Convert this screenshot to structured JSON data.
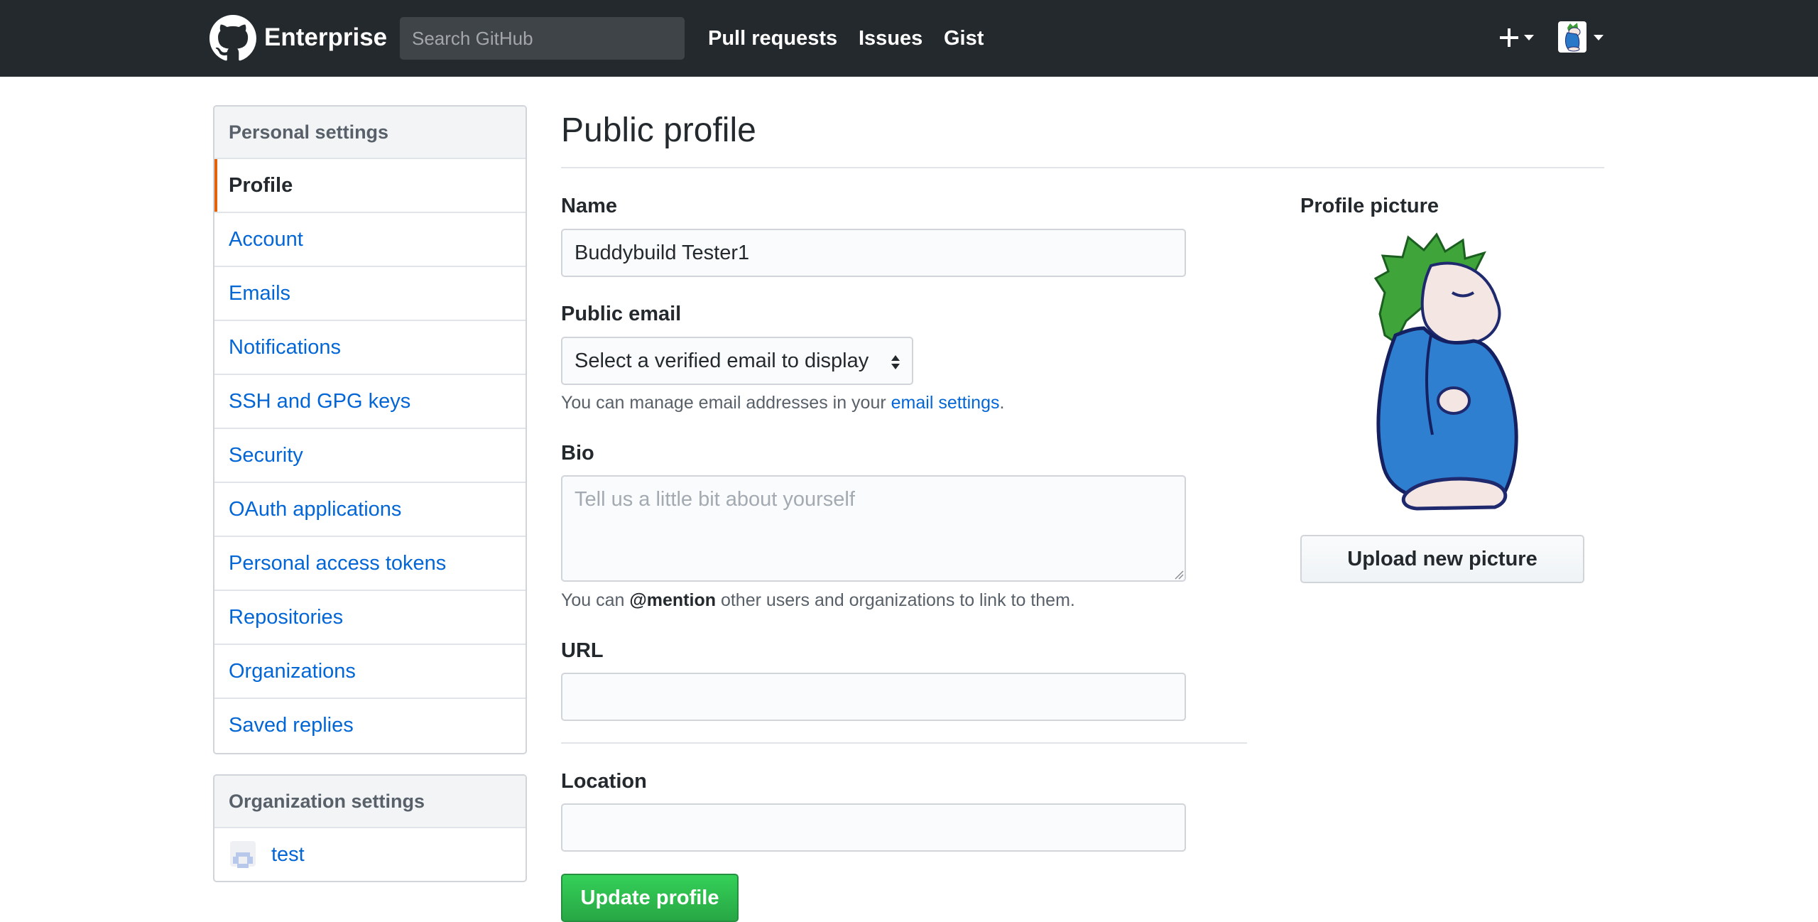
{
  "header": {
    "brand": "Enterprise",
    "search_placeholder": "Search GitHub",
    "nav": [
      "Pull requests",
      "Issues",
      "Gist"
    ],
    "new_symbol": "+"
  },
  "sidebar": {
    "heading": "Personal settings",
    "items": [
      {
        "label": "Profile",
        "selected": true
      },
      {
        "label": "Account"
      },
      {
        "label": "Emails"
      },
      {
        "label": "Notifications"
      },
      {
        "label": "SSH and GPG keys"
      },
      {
        "label": "Security"
      },
      {
        "label": "OAuth applications"
      },
      {
        "label": "Personal access tokens"
      },
      {
        "label": "Repositories"
      },
      {
        "label": "Organizations"
      },
      {
        "label": "Saved replies"
      }
    ],
    "org_heading": "Organization settings",
    "orgs": [
      {
        "label": "test"
      }
    ]
  },
  "main": {
    "title": "Public profile",
    "name_label": "Name",
    "name_value": "Buddybuild Tester1",
    "email_label": "Public email",
    "email_select": "Select a verified email to display",
    "email_note_prefix": "You can manage email addresses in your ",
    "email_note_link": "email settings",
    "email_note_suffix": ".",
    "bio_label": "Bio",
    "bio_placeholder": "Tell us a little bit about yourself",
    "bio_note_prefix": "You can ",
    "bio_note_mention": "@mention",
    "bio_note_suffix": " other users and organizations to link to them.",
    "url_label": "URL",
    "url_value": "",
    "location_label": "Location",
    "location_value": "",
    "submit_label": "Update profile"
  },
  "picture": {
    "label": "Profile picture",
    "upload_label": "Upload new picture"
  },
  "colors": {
    "header_bg": "#24292e",
    "link": "#0366d6",
    "selected_marker": "#e36209",
    "primary_button": "#28a745"
  }
}
